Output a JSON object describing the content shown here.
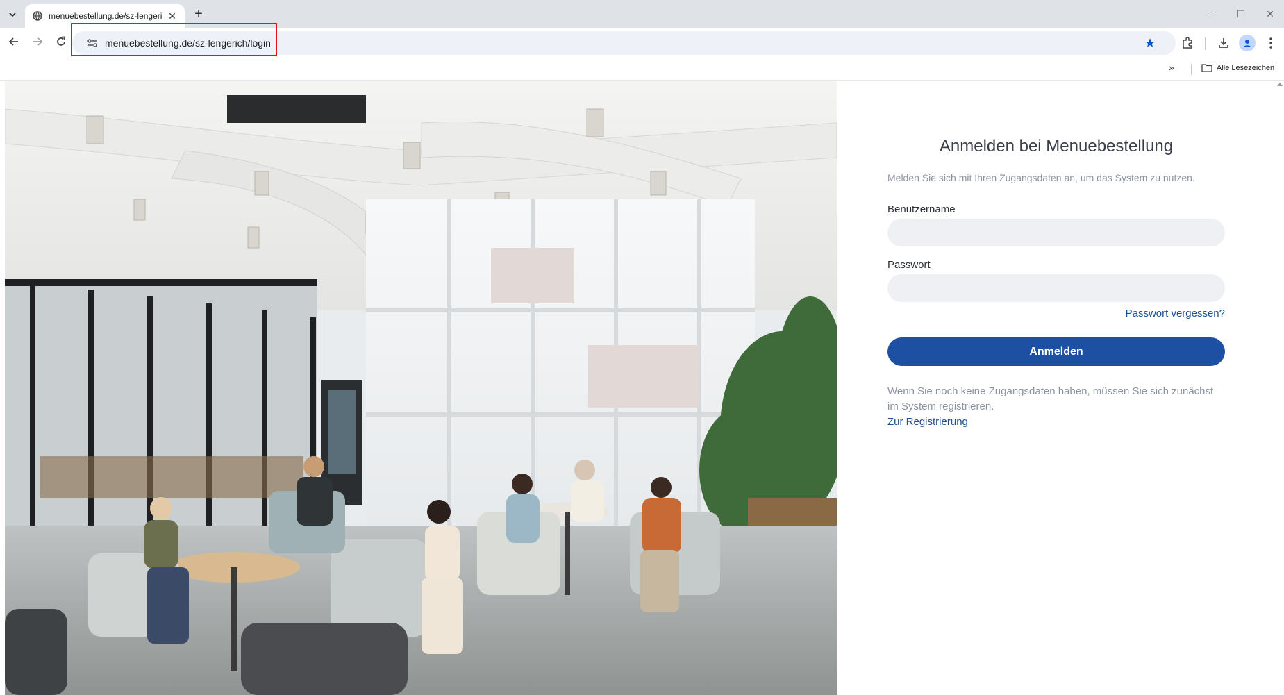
{
  "browser": {
    "tab": {
      "title": "menuebestellung.de/sz-lengeri",
      "close_glyph": "✕"
    },
    "new_tab_glyph": "+",
    "window_controls": {
      "minimize": "–",
      "maximize": "☐",
      "close": "✕"
    },
    "address_bar": {
      "url": "menuebestellung.de/sz-lengerich/login"
    },
    "bookmarks_bar": {
      "more_glyph": "»",
      "all_bookmarks_label": "Alle Lesezeichen"
    },
    "icons": {
      "tab_search": "chevron-down-icon",
      "favicon": "globe-icon",
      "back": "arrow-left-icon",
      "forward": "arrow-right-icon",
      "reload": "reload-icon",
      "site_info": "tune-icon",
      "bookmark": "star-icon",
      "extensions": "puzzle-icon",
      "downloads": "download-icon",
      "profile": "person-icon",
      "menu": "kebab-icon",
      "folder": "folder-icon"
    },
    "colors": {
      "bookmark_star": "#0b57d0",
      "url_highlight": "#e0161e"
    }
  },
  "login": {
    "title": "Anmelden bei Menuebestellung",
    "subtitle": "Melden Sie sich mit Ihren Zugangsdaten an, um das System zu nutzen.",
    "username_label": "Benutzername",
    "username_value": "",
    "password_label": "Passwort",
    "password_value": "",
    "forgot_link": "Passwort vergessen?",
    "submit_label": "Anmelden",
    "register_text": "Wenn Sie noch keine Zugangsdaten haben, müssen Sie sich zunächst im System registrieren.",
    "register_link": "Zur Registrierung",
    "colors": {
      "primary": "#1d4fa3",
      "link": "#1f4f8f",
      "muted": "#8b93a1",
      "input_bg": "#eef0f3"
    }
  }
}
